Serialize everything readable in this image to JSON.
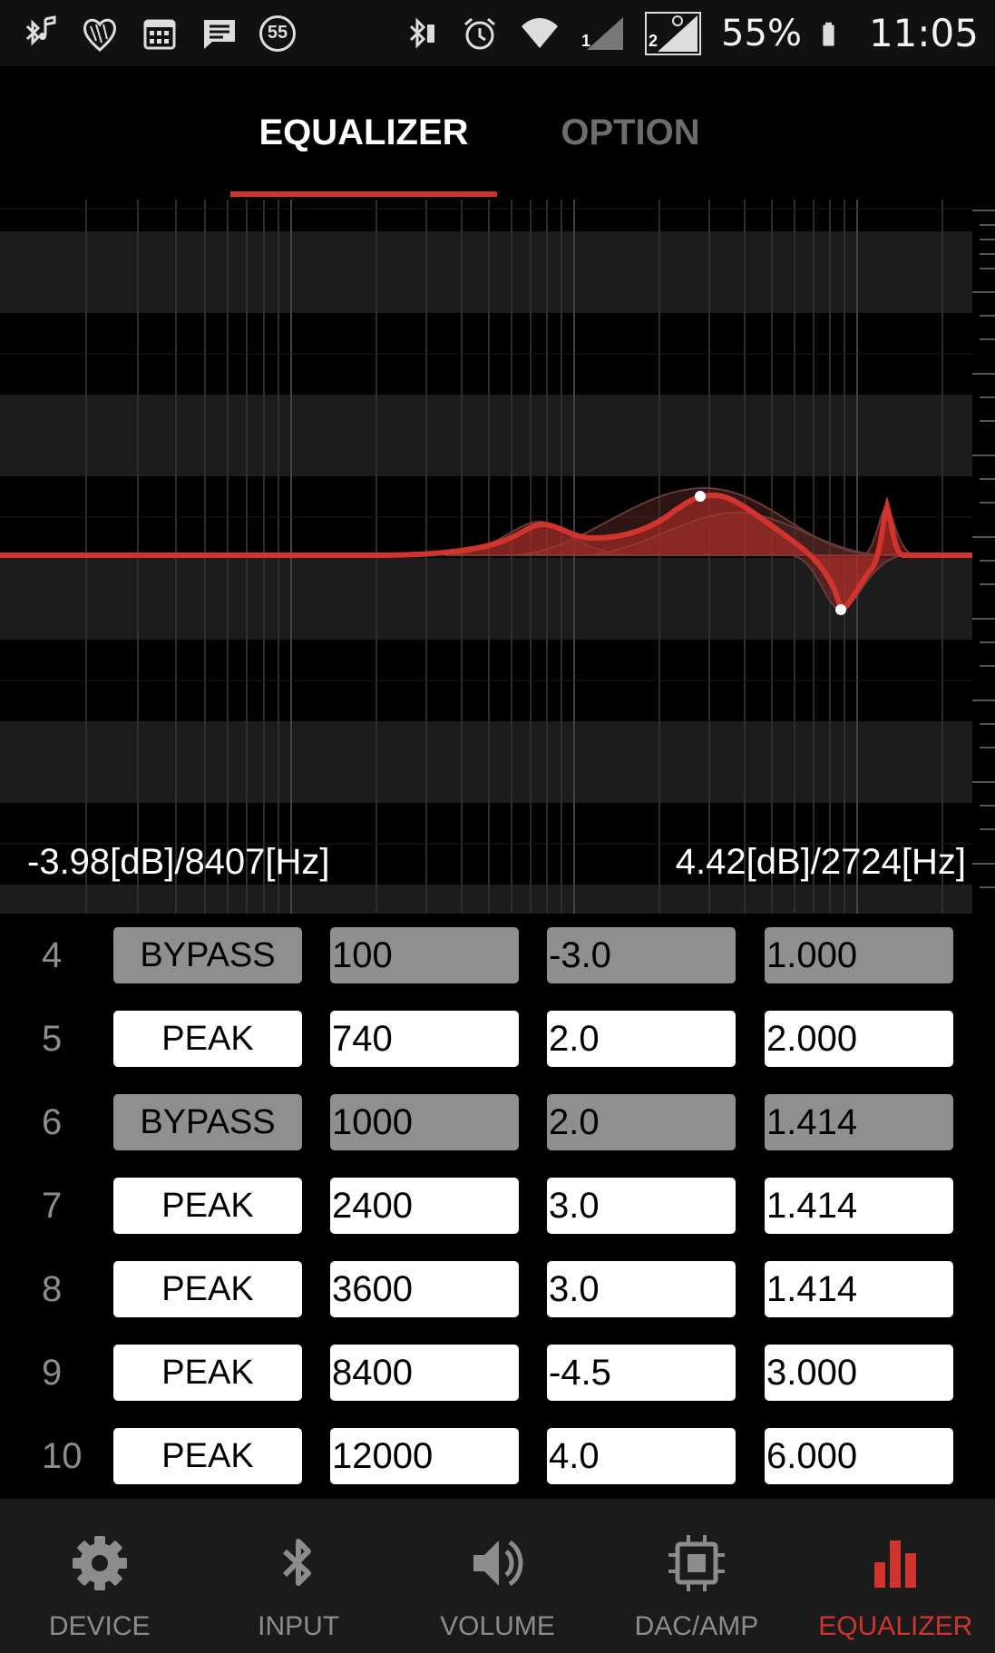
{
  "status_bar": {
    "notification_icons": [
      "bluetooth-music-icon",
      "heart-icon",
      "calendar-icon",
      "message-icon",
      "badge-55-icon"
    ],
    "badge_text": "55",
    "system_icons": [
      "bluetooth-icon",
      "alarm-icon",
      "wifi-icon",
      "signal-1-icon",
      "signal-2-icon",
      "battery-icon"
    ],
    "sim1_label": "1",
    "sim2_label": "2",
    "battery_percent": "55%",
    "time": "11:05"
  },
  "tabs": [
    {
      "label": "EQUALIZER",
      "active": true
    },
    {
      "label": "OPTION",
      "active": false
    }
  ],
  "graph": {
    "left_readout": "-3.98[dB]/8407[Hz]",
    "right_readout": "4.42[dB]/2724[Hz]",
    "curve_color": "#d0342c"
  },
  "bands": [
    {
      "number": "4",
      "type": "BYPASS",
      "freq": "100",
      "gain": "-3.0",
      "q": "1.000",
      "enabled": false
    },
    {
      "number": "5",
      "type": "PEAK",
      "freq": "740",
      "gain": "2.0",
      "q": "2.000",
      "enabled": true
    },
    {
      "number": "6",
      "type": "BYPASS",
      "freq": "1000",
      "gain": "2.0",
      "q": "1.414",
      "enabled": false
    },
    {
      "number": "7",
      "type": "PEAK",
      "freq": "2400",
      "gain": "3.0",
      "q": "1.414",
      "enabled": true
    },
    {
      "number": "8",
      "type": "PEAK",
      "freq": "3600",
      "gain": "3.0",
      "q": "1.414",
      "enabled": true
    },
    {
      "number": "9",
      "type": "PEAK",
      "freq": "8400",
      "gain": "-4.5",
      "q": "3.000",
      "enabled": true
    },
    {
      "number": "10",
      "type": "PEAK",
      "freq": "12000",
      "gain": "4.0",
      "q": "6.000",
      "enabled": true
    }
  ],
  "bottom_nav": [
    {
      "label": "DEVICE",
      "icon": "gear-icon",
      "active": false
    },
    {
      "label": "INPUT",
      "icon": "bluetooth-icon",
      "active": false
    },
    {
      "label": "VOLUME",
      "icon": "speaker-icon",
      "active": false
    },
    {
      "label": "DAC/AMP",
      "icon": "chip-icon",
      "active": false
    },
    {
      "label": "EQUALIZER",
      "icon": "equalizer-bars-icon",
      "active": true
    }
  ],
  "colors": {
    "accent": "#d0342c",
    "inactive_cell": "#8f8f8f",
    "active_cell": "#ffffff",
    "nav_bg": "#1b1b1b"
  }
}
